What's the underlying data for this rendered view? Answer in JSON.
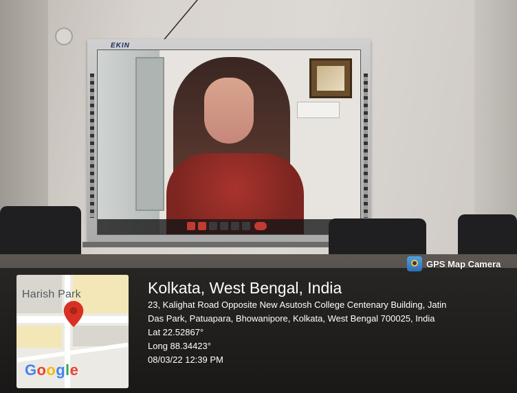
{
  "screen_brand": "EKIN",
  "badge": {
    "label": "GPS Map Camera",
    "icon": "camera-pin-icon"
  },
  "map": {
    "place_label": "Harish Park",
    "logo_text": "Google",
    "pin_color": "#d93025"
  },
  "location": {
    "title": "Kolkata, West Bengal, India",
    "address_line1": "23, Kalighat Road Opposite New Asutosh College Centenary Building, Jatin",
    "address_line2": "Das Park, Patuapara, Bhowanipore, Kolkata, West Bengal 700025, India",
    "lat": "Lat 22.52867°",
    "long": "Long 88.34423°",
    "datetime": "08/03/22 12:39 PM"
  }
}
